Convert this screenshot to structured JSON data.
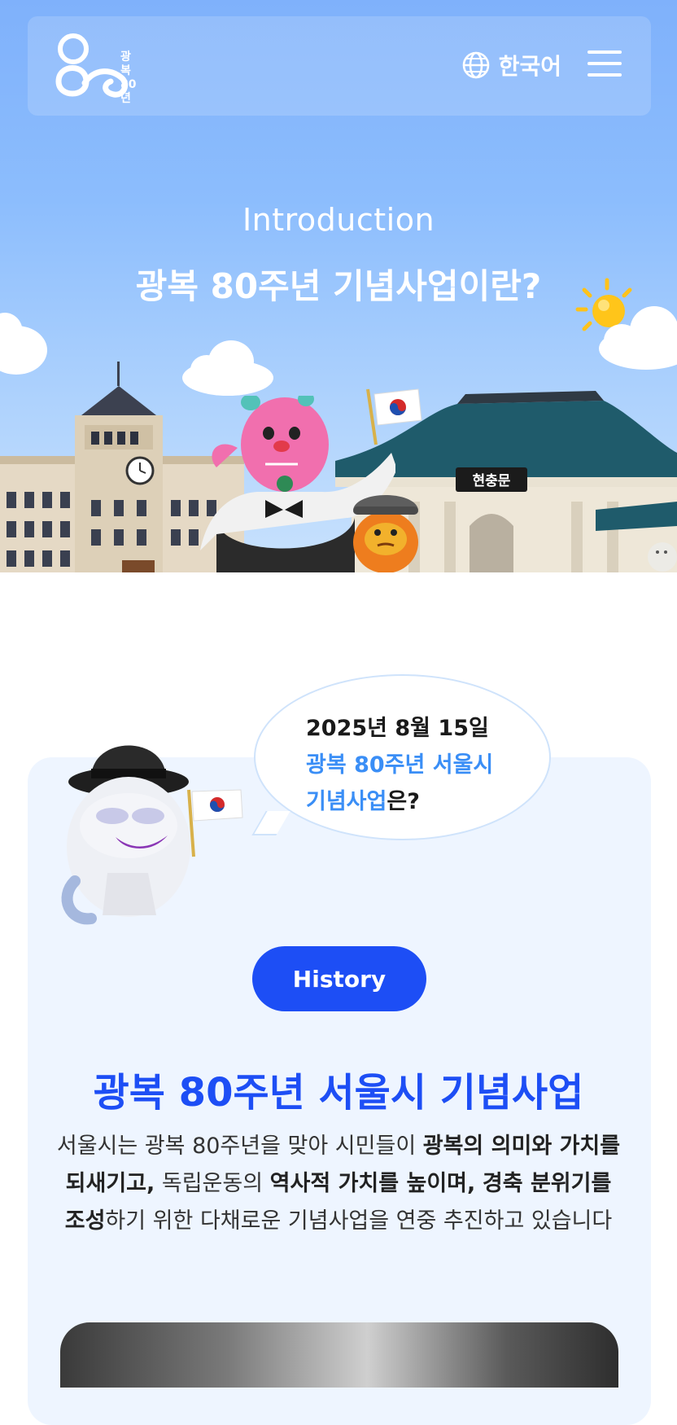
{
  "header": {
    "logo_text_line1": "광복",
    "logo_text_line2": "80년",
    "language_label": "한국어"
  },
  "hero": {
    "kicker": "Introduction",
    "title": "광복 80주년 기념사업이란?",
    "sign_text": "현충문"
  },
  "bubble": {
    "date": "2025년 8월 15일",
    "line2": "광복 80주년 서울시",
    "line3_highlight": "기념사업",
    "line3_suffix": "은?"
  },
  "section": {
    "badge": "History",
    "title": "광복 80주년 서울시 기념사업",
    "body_1": "서울시는 광복 80주년을 맞아 시민들이 ",
    "body_2": "광복의 의미와 가치를 되새기고,",
    "body_3": " 독립운동의 ",
    "body_4": "역사적 가치를 높이며,",
    "body_5": " ",
    "body_6": "경축 분위기를 조성",
    "body_7": "하기 위한 다채로운 기념사업을 연중 추진하고 있습니다"
  },
  "colors": {
    "primary_blue": "#1d4ef5",
    "light_blue": "#3a8ef6",
    "sky": "#8cbdfd"
  },
  "icons": {
    "globe": "globe-icon",
    "menu": "hamburger-menu-icon"
  }
}
